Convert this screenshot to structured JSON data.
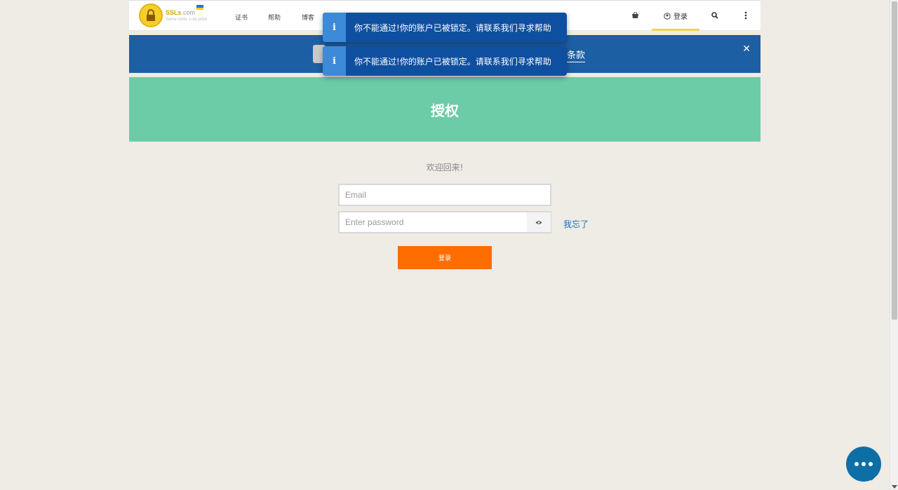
{
  "header": {
    "logo_name": "SSLs",
    "logo_domain": ".com",
    "logo_tagline": "Same certs. Low price",
    "nav": [
      "证书",
      "帮助",
      "博客"
    ],
    "login_label": "登录"
  },
  "banner": {
    "link_text": "条款",
    "close_symbol": "✕"
  },
  "auth": {
    "title": "授权",
    "welcome": "欢迎回来!",
    "email_placeholder": "Email",
    "password_placeholder": "Enter password",
    "forgot_label": "我忘了",
    "login_button": "登录"
  },
  "toasts": [
    {
      "icon": "i",
      "message": "你不能通过!你的账户已被锁定。请联系我们寻求帮助"
    },
    {
      "icon": "i",
      "message": "你不能通过!你的账户已被锁定。请联系我们寻求帮助"
    }
  ],
  "icons": {
    "cart": "basket-icon",
    "user": "user-circle-icon",
    "search": "search-icon",
    "more": "kebab-menu-icon",
    "eye": "eye-icon",
    "chat": "chat-icon"
  },
  "colors": {
    "banner": "#1d5fa3",
    "auth_header": "#6ccca8",
    "login_button": "#ff6d00",
    "toast": "#0f4fa0",
    "chat": "#0e6fa6"
  }
}
